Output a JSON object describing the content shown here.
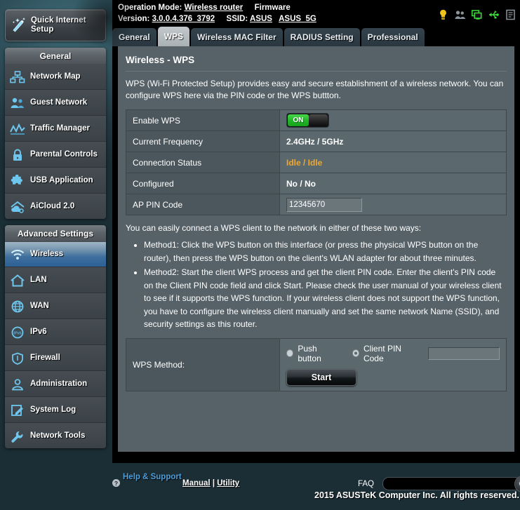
{
  "sidebar": {
    "quick_setup": {
      "label": "Quick Internet Setup",
      "icon": "magic-wand-icon"
    },
    "general_header": "General",
    "general_items": [
      {
        "label": "Network Map",
        "icon": "network-map-icon"
      },
      {
        "label": "Guest Network",
        "icon": "guest-network-icon"
      },
      {
        "label": "Traffic Manager",
        "icon": "traffic-manager-icon"
      },
      {
        "label": "Parental Controls",
        "icon": "parental-lock-icon"
      },
      {
        "label": "USB Application",
        "icon": "usb-puzzle-icon"
      },
      {
        "label": "AiCloud 2.0",
        "icon": "aicloud-icon"
      }
    ],
    "advanced_header": "Advanced Settings",
    "advanced_items": [
      {
        "label": "Wireless",
        "icon": "wifi-icon",
        "active": true
      },
      {
        "label": "LAN",
        "icon": "home-icon",
        "active": false
      },
      {
        "label": "WAN",
        "icon": "globe-icon",
        "active": false
      },
      {
        "label": "IPv6",
        "icon": "ipv6-icon",
        "active": false
      },
      {
        "label": "Firewall",
        "icon": "shield-icon",
        "active": false
      },
      {
        "label": "Administration",
        "icon": "user-icon",
        "active": false
      },
      {
        "label": "System Log",
        "icon": "pencil-note-icon",
        "active": false
      },
      {
        "label": "Network Tools",
        "icon": "wrench-icon",
        "active": false
      }
    ]
  },
  "header": {
    "operation_mode_label": "Operation Mode:",
    "operation_mode_value": "Wireless router",
    "firmware_label": "Firmware",
    "version_label": "Version:",
    "version_value": "3.0.0.4.376_3792",
    "ssid_label": "SSID:",
    "ssid_value_1": "ASUS",
    "ssid_value_2": "ASUS_5G",
    "tray_icons": [
      {
        "name": "notification-bulb-icon",
        "color": "#f0c419"
      },
      {
        "name": "guest-users-icon",
        "color": "#8d9499"
      },
      {
        "name": "connected-clients-icon",
        "color": "#3ddd3d"
      },
      {
        "name": "usb-device-icon",
        "color": "#3ddd3d"
      },
      {
        "name": "system-log-icon",
        "color": "#8d9499"
      }
    ]
  },
  "tabs": [
    {
      "label": "General",
      "active": false
    },
    {
      "label": "WPS",
      "active": true
    },
    {
      "label": "Wireless MAC Filter",
      "active": false
    },
    {
      "label": "RADIUS Setting",
      "active": false
    },
    {
      "label": "Professional",
      "active": false
    }
  ],
  "main": {
    "title": "Wireless - WPS",
    "description": "WPS (Wi-Fi Protected Setup) provides easy and secure establishment of a wireless network. You can configure WPS here via the PIN code or the WPS buttton.",
    "settings_rows": [
      {
        "key": "Enable WPS",
        "type": "toggle",
        "value": "ON"
      },
      {
        "key": "Current Frequency",
        "type": "text",
        "value": "2.4GHz / 5GHz"
      },
      {
        "key": "Connection Status",
        "type": "status",
        "value": "Idle / Idle"
      },
      {
        "key": "Configured",
        "type": "text",
        "value": "No / No"
      },
      {
        "key": "AP PIN Code",
        "type": "input",
        "value": "12345670"
      }
    ],
    "howto_intro": "You can easily connect a WPS client to the network in either of these two ways:",
    "methods": [
      "Method1: Click the WPS button on this interface (or press the physical WPS button on the router), then press the WPS button on the client's WLAN adapter for about three minutes.",
      "Method2: Start the client WPS process and get the client PIN code. Enter the client's PIN code on the Client PIN code field and click Start. Please check the user manual of your wireless client to see if it supports the WPS function. If your wireless client does not support the WPS function, you have to configure the wireless client manually and set the same network Name (SSID), and security settings as this router."
    ],
    "wps_method": {
      "label": "WPS Method:",
      "push_button_label": "Push button",
      "push_button_selected": true,
      "client_pin_label": "Client PIN Code",
      "client_pin_selected": false,
      "client_pin_value": "",
      "start_label": "Start"
    }
  },
  "footer": {
    "help_icon_glyph": "?",
    "help_label": "Help & Support",
    "manual_label": "Manual",
    "separator": "|",
    "utility_label": "Utility",
    "faq_label": "FAQ",
    "faq_query": "",
    "search_icon": "search-icon",
    "copyright": "2015 ASUSTeK Computer Inc. All rights reserved."
  },
  "colors": {
    "accent_blue": "#6ec6ee",
    "active_nav": "#2d6094",
    "status_orange": "#f0a830",
    "toggle_green": "#1fb526",
    "panel_bg": "#566268"
  }
}
